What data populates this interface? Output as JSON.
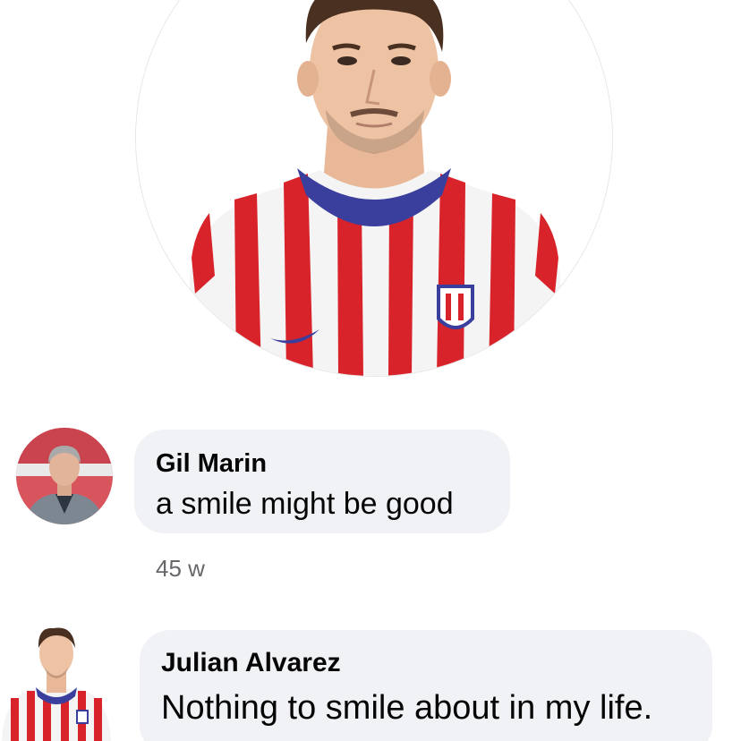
{
  "post": {
    "profile_photo": "footballer-portrait-red-white-striped-jersey"
  },
  "comments": [
    {
      "avatar": "older-man-portrait",
      "author": "Gil Marin",
      "text": "a smile might be good",
      "timestamp": "45 w"
    },
    {
      "avatar": "footballer-portrait",
      "author": "Julian Alvarez",
      "text": "Nothing to smile about in my life."
    }
  ],
  "colors": {
    "bubble": "#f0f2f5",
    "text": "#050505",
    "meta": "#65676b",
    "jersey_red": "#d8232a",
    "jersey_collar": "#3a3f9e"
  }
}
